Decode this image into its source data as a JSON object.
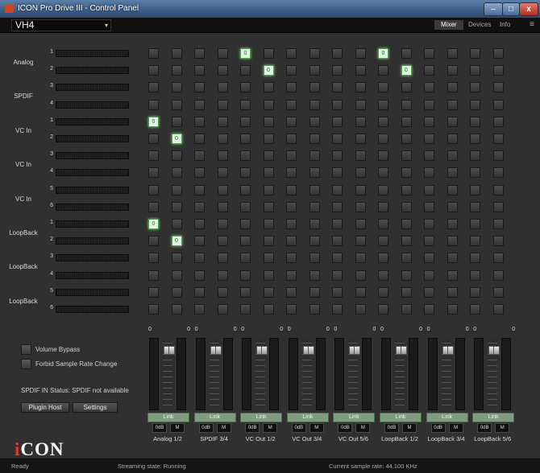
{
  "window": {
    "title": "ICON Pro Drive III - Control Panel"
  },
  "toolbar": {
    "device": "VH4",
    "tabs": [
      "Mixer",
      "Devices",
      "Info"
    ],
    "active_tab": "Mixer",
    "menu_glyph": "≡"
  },
  "inputs": [
    {
      "label": "Analog",
      "channels": [
        "1",
        "2"
      ]
    },
    {
      "label": "SPDIF",
      "channels": [
        "3",
        "4"
      ]
    },
    {
      "label": "VC In",
      "channels": [
        "1",
        "2"
      ]
    },
    {
      "label": "VC In",
      "channels": [
        "3",
        "4"
      ]
    },
    {
      "label": "VC In",
      "channels": [
        "5",
        "6"
      ]
    },
    {
      "label": "LoopBack",
      "channels": [
        "1",
        "2"
      ]
    },
    {
      "label": "LoopBack",
      "channels": [
        "3",
        "4"
      ]
    },
    {
      "label": "LoopBack",
      "channels": [
        "5",
        "6"
      ]
    }
  ],
  "matrix": {
    "rows": 16,
    "cols": 16,
    "active_label": "0",
    "active": [
      [
        0,
        4
      ],
      [
        0,
        10
      ],
      [
        1,
        5
      ],
      [
        1,
        11
      ],
      [
        4,
        0
      ],
      [
        5,
        1
      ],
      [
        10,
        0
      ],
      [
        11,
        1
      ]
    ]
  },
  "outputs": [
    {
      "label": "Analog 1/2",
      "left_value": "0",
      "right_value": "0",
      "link": "Link",
      "mute_left": "0dB",
      "mute_right": "M"
    },
    {
      "label": "SPDIF 3/4",
      "left_value": "0",
      "right_value": "0",
      "link": "Link",
      "mute_left": "0dB",
      "mute_right": "M"
    },
    {
      "label": "VC Out 1/2",
      "left_value": "0",
      "right_value": "0",
      "link": "Link",
      "mute_left": "0dB",
      "mute_right": "M"
    },
    {
      "label": "VC Out 3/4",
      "left_value": "0",
      "right_value": "0",
      "link": "Link",
      "mute_left": "0dB",
      "mute_right": "M"
    },
    {
      "label": "VC Out 5/6",
      "left_value": "0",
      "right_value": "0",
      "link": "Link",
      "mute_left": "0dB",
      "mute_right": "M"
    },
    {
      "label": "LoopBack 1/2",
      "left_value": "0",
      "right_value": "0",
      "link": "Link",
      "mute_left": "0dB",
      "mute_right": "M"
    },
    {
      "label": "LoopBack 3/4",
      "left_value": "0",
      "right_value": "0",
      "link": "Link",
      "mute_left": "0dB",
      "mute_right": "M"
    },
    {
      "label": "LoopBack 5/6",
      "left_value": "0",
      "right_value": "0",
      "link": "Link",
      "mute_left": "0dB",
      "mute_right": "M"
    }
  ],
  "options": {
    "volume_bypass": "Volume Bypass",
    "forbid_sample_rate_change": "Forbid Sample Rate Change",
    "spdif_status": "SPDIF IN Status: SPDIF not available",
    "plugin_host": "Plugin Host",
    "settings": "Settings"
  },
  "logo": {
    "text": "iCON",
    "accent": "#e0392a"
  },
  "status": {
    "left": "Ready",
    "streaming": "Streaming state: Running",
    "sample_rate": "Current sample rate: 44.100 KHz"
  },
  "colors": {
    "active_cell": "#dff7df",
    "link_button": "#7f9d7f",
    "title_bar": "#3d5d86"
  }
}
